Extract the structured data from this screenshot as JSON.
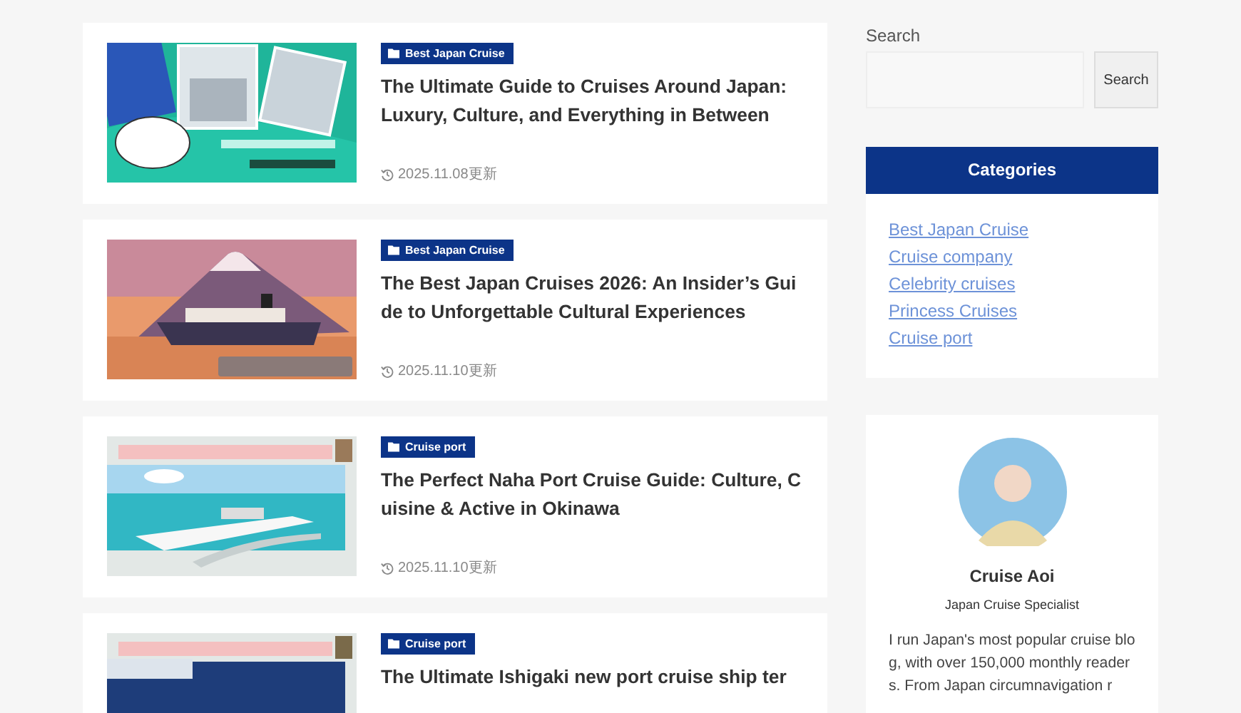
{
  "posts": [
    {
      "category": "Best Japan Cruise",
      "title": "The Ultimate Guide to Cruises Around Japan: Luxury, Culture, and Everything in Between",
      "date": "2025.11.08更新"
    },
    {
      "category": "Best Japan Cruise",
      "title": "The Best Japan Cruises 2026: An Insider’s Guide to Unforgettable Cultural Experiences",
      "date": "2025.11.10更新"
    },
    {
      "category": "Cruise port",
      "title": "The Perfect Naha Port Cruise Guide: Culture, Cuisine & Active in Okinawa",
      "date": "2025.11.10更新"
    },
    {
      "category": "Cruise port",
      "title": "The Ultimate Ishigaki new port cruise ship ter"
    }
  ],
  "sidebar": {
    "search": {
      "label": "Search",
      "button": "Search"
    },
    "categories": {
      "title": "Categories",
      "items": [
        "Best Japan Cruise",
        "Cruise company",
        "Celebrity cruises",
        "Princess Cruises",
        "Cruise port"
      ]
    },
    "profile": {
      "name": "Cruise Aoi",
      "role": "Japan Cruise Specialist",
      "bio": "I run Japan's most popular cruise blog, with over 150,000 monthly readers. From Japan circumnavigation r"
    }
  }
}
